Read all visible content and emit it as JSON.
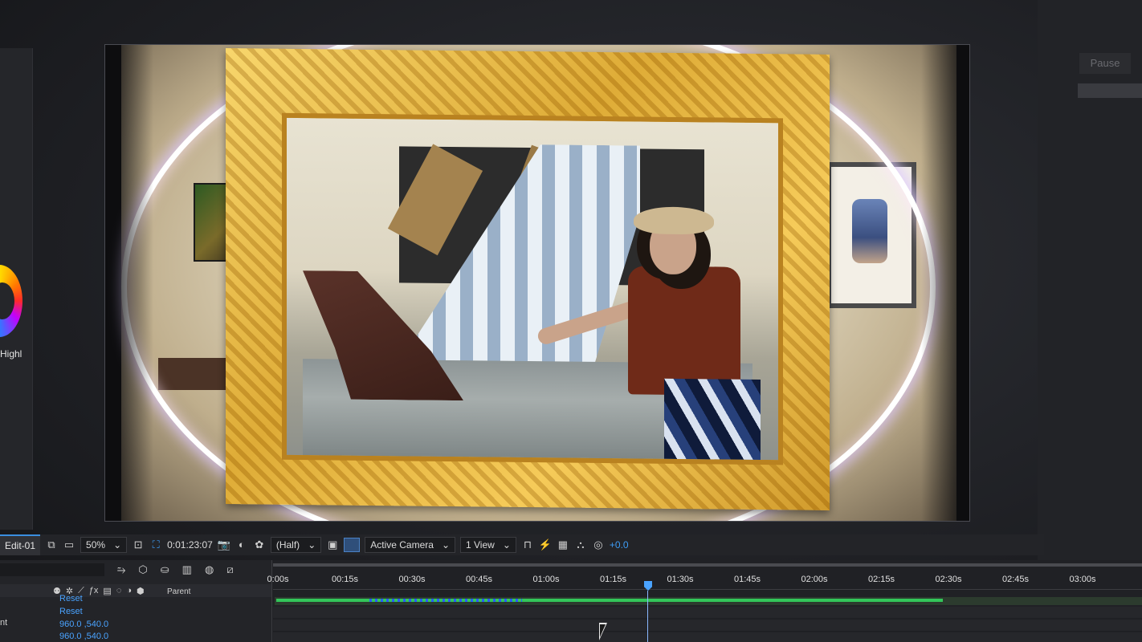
{
  "left_panel": {
    "highlight_label": "Highl"
  },
  "right_panel": {
    "pause_label": "Pause"
  },
  "viewer_toolbar": {
    "comp_tab": "Edit-01",
    "zoom": "50%",
    "timecode": "0:01:23:07",
    "resolution": "(Half)",
    "camera": "Active Camera",
    "views": "1 View",
    "exposure": "+0.0"
  },
  "timeline": {
    "ruler_ticks": [
      "0:00s",
      "00:15s",
      "00:30s",
      "00:45s",
      "01:00s",
      "01:15s",
      "01:30s",
      "01:45s",
      "02:00s",
      "02:15s",
      "02:30s",
      "02:45s",
      "03:00s"
    ],
    "parent_label": "Parent",
    "properties": [
      {
        "name": "",
        "value": "Reset"
      },
      {
        "name": "",
        "value": "Reset"
      },
      {
        "name": "nt",
        "value": "960.0 ,540.0"
      },
      {
        "name": "",
        "value": "960.0 ,540.0"
      }
    ],
    "current_time_s": 83,
    "duration_s": 180
  }
}
